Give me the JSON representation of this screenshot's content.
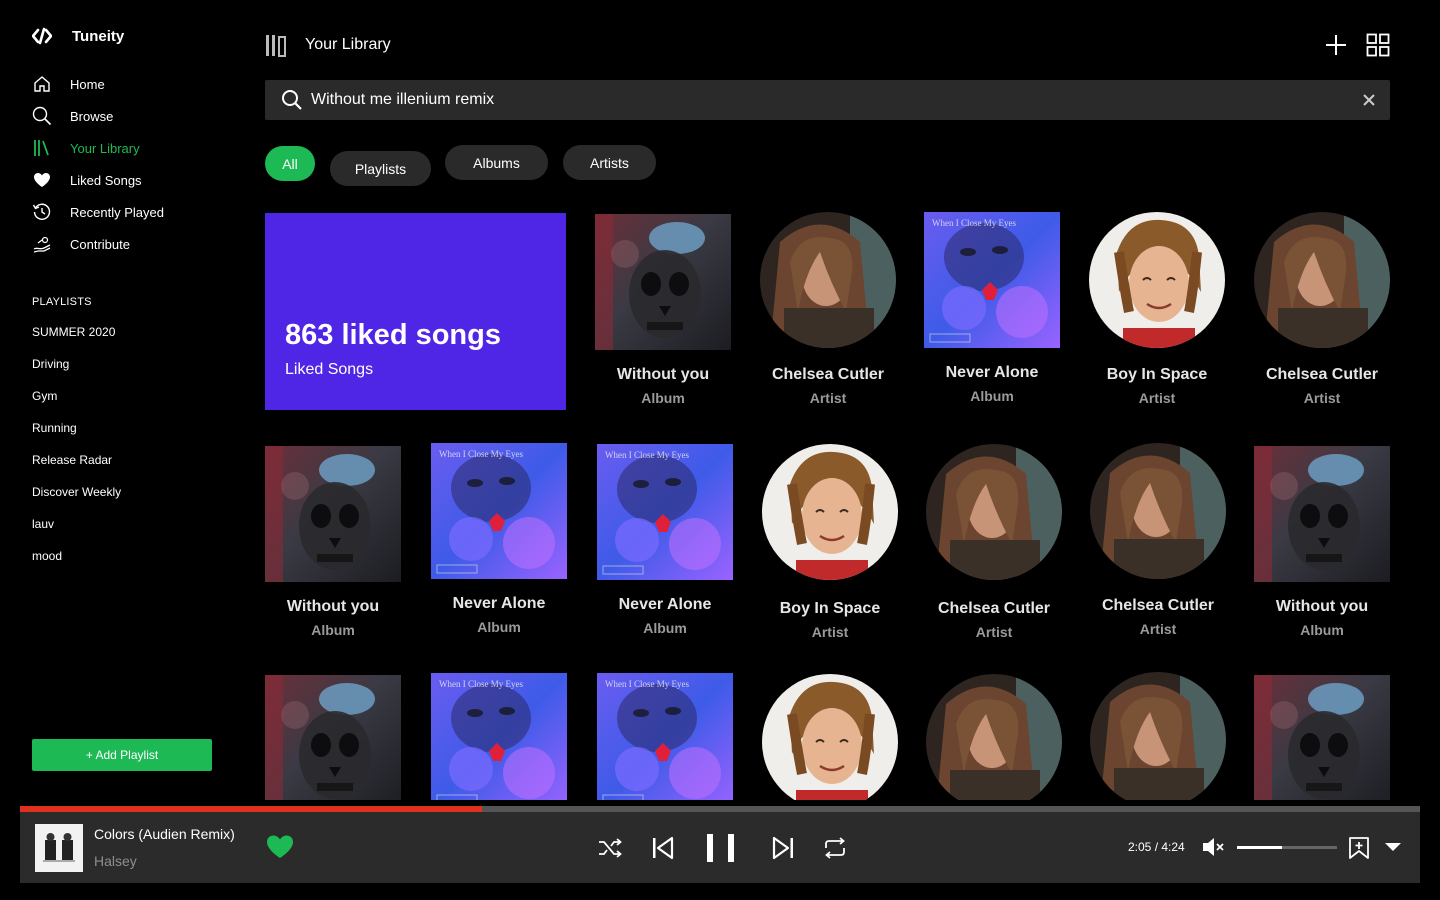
{
  "app": {
    "name": "Tuneity"
  },
  "sidebar": {
    "nav": [
      {
        "label": "Home",
        "icon": "home-icon"
      },
      {
        "label": "Browse",
        "icon": "search-icon"
      },
      {
        "label": "Your Library",
        "icon": "library-icon",
        "active": true
      },
      {
        "label": "Liked Songs",
        "icon": "heart-icon"
      },
      {
        "label": "Recently Played",
        "icon": "history-icon"
      },
      {
        "label": "Contribute",
        "icon": "contribute-icon"
      }
    ],
    "playlists_heading": "PLAYLISTS",
    "playlists": [
      "SUMMER 2020",
      "Driving",
      "Gym",
      "Running",
      "Release Radar",
      "Discover Weekly",
      "lauv",
      "mood"
    ],
    "add_playlist_label": "+ Add Playlist"
  },
  "header": {
    "title": "Your Library"
  },
  "search": {
    "value": "Without me illenium remix"
  },
  "filters": [
    "All",
    "Playlists",
    "Albums",
    "Artists"
  ],
  "active_filter": "All",
  "liked_card": {
    "count": "863 liked songs",
    "label": "Liked Songs"
  },
  "grid": {
    "row1": [
      {
        "title": "Without you",
        "subtitle": "Album",
        "art": "skull"
      },
      {
        "title": "Chelsea Cutler",
        "subtitle": "Artist",
        "art": "chelsea"
      },
      {
        "title": "Never Alone",
        "subtitle": "Album",
        "art": "never"
      },
      {
        "title": "Boy In Space",
        "subtitle": "Artist",
        "art": "boy"
      },
      {
        "title": "Chelsea Cutler",
        "subtitle": "Artist",
        "art": "chelsea"
      }
    ],
    "row2": [
      {
        "title": "Without you",
        "subtitle": "Album",
        "art": "skull"
      },
      {
        "title": "Never Alone",
        "subtitle": "Album",
        "art": "never"
      },
      {
        "title": "Never Alone",
        "subtitle": "Album",
        "art": "never"
      },
      {
        "title": "Boy In Space",
        "subtitle": "Artist",
        "art": "boy"
      },
      {
        "title": "Chelsea Cutler",
        "subtitle": "Artist",
        "art": "chelsea"
      },
      {
        "title": "Chelsea Cutler",
        "subtitle": "Artist",
        "art": "chelsea"
      },
      {
        "title": "Without you",
        "subtitle": "Album",
        "art": "skull"
      }
    ],
    "row3": [
      {
        "art": "skull"
      },
      {
        "art": "never"
      },
      {
        "art": "never"
      },
      {
        "art": "boy"
      },
      {
        "art": "chelsea"
      },
      {
        "art": "chelsea"
      },
      {
        "art": "skull"
      }
    ]
  },
  "player": {
    "title": "Colors (Audien Remix)",
    "artist": "Halsey",
    "time": "2:05 / 4:24",
    "progress": 0.33,
    "volume": 0.45,
    "liked": true
  },
  "colors": {
    "accent": "#1db954",
    "liked_card": "#4f26e6",
    "progress": "#e0301e"
  }
}
